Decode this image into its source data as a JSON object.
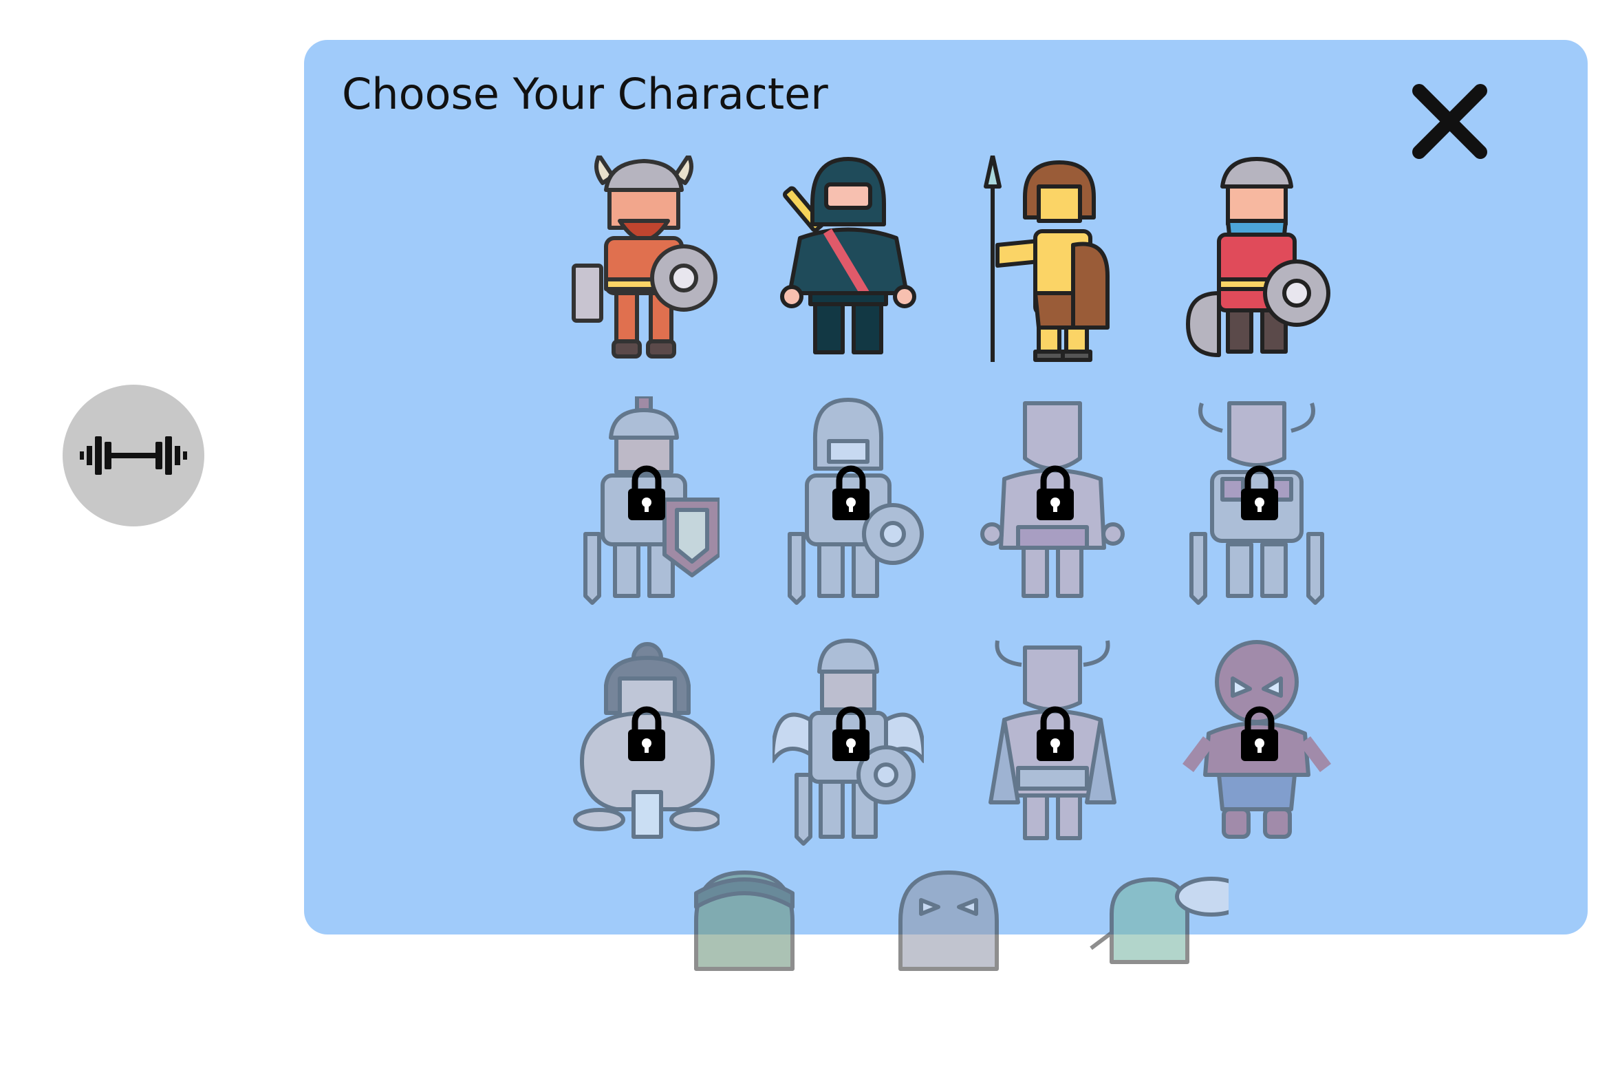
{
  "modal": {
    "title": "Choose Your Character"
  },
  "icons": {
    "side_button": "dumbbell-icon",
    "close": "close-icon",
    "lock": "lock-icon"
  },
  "colors": {
    "modal_bg": "#a0cbfa",
    "side_button_bg": "#c8c8c8"
  },
  "characters": [
    {
      "name": "viking",
      "locked": false
    },
    {
      "name": "ninja",
      "locked": false
    },
    {
      "name": "spearman",
      "locked": false
    },
    {
      "name": "axe-knight",
      "locked": false
    },
    {
      "name": "gladiator",
      "locked": true
    },
    {
      "name": "knight",
      "locked": true
    },
    {
      "name": "cyclops",
      "locked": true
    },
    {
      "name": "horned-warrior",
      "locked": true
    },
    {
      "name": "sumo",
      "locked": true
    },
    {
      "name": "winged-knight",
      "locked": true
    },
    {
      "name": "minotaur",
      "locked": true
    },
    {
      "name": "spider-hero",
      "locked": true
    },
    {
      "name": "zombie",
      "locked": true
    },
    {
      "name": "bat-hero",
      "locked": true
    },
    {
      "name": "goblin",
      "locked": true
    }
  ]
}
